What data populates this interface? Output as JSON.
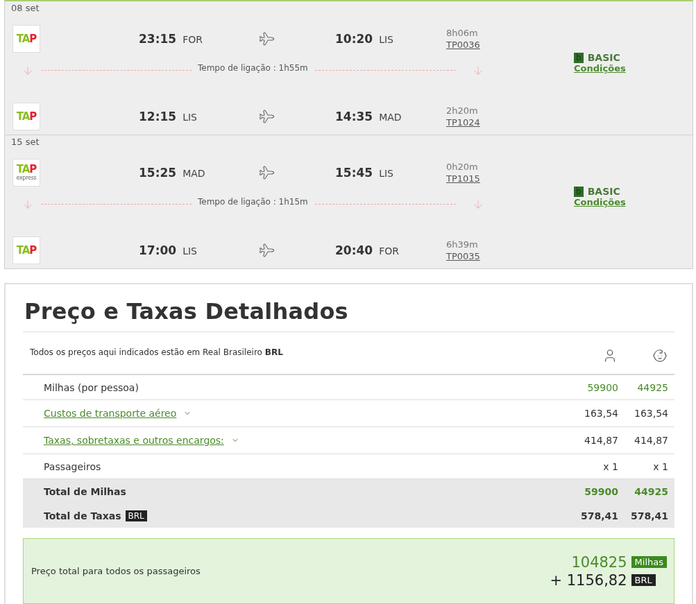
{
  "trips": [
    {
      "date": "08 set",
      "segments": [
        {
          "logo": {
            "text_a": "TA",
            "text_b": "P"
          },
          "dep_time": "23:15",
          "dep_airport": "FOR",
          "arr_time": "10:20",
          "arr_airport": "LIS",
          "duration": "8h06m",
          "flight": "TP0036"
        },
        {
          "logo": {
            "text_a": "TA",
            "text_b": "P"
          },
          "dep_time": "12:15",
          "dep_airport": "LIS",
          "arr_time": "14:35",
          "arr_airport": "MAD",
          "duration": "2h20m",
          "flight": "TP1024"
        }
      ],
      "connection": "Tempo de ligação : 1h55m",
      "fare": {
        "badge": "b",
        "name": "BASIC",
        "link": "Condições"
      }
    },
    {
      "date": "15 set",
      "segments": [
        {
          "logo": {
            "text_a": "TA",
            "text_b": "P",
            "sub": "express"
          },
          "dep_time": "15:25",
          "dep_airport": "MAD",
          "arr_time": "15:45",
          "arr_airport": "LIS",
          "duration": "0h20m",
          "flight": "TP1015"
        },
        {
          "logo": {
            "text_a": "TA",
            "text_b": "P"
          },
          "dep_time": "17:00",
          "dep_airport": "LIS",
          "arr_time": "20:40",
          "arr_airport": "FOR",
          "duration": "6h39m",
          "flight": "TP0035"
        }
      ],
      "connection": "Tempo de ligação : 1h15m",
      "fare": {
        "badge": "b",
        "name": "BASIC",
        "link": "Condições"
      }
    }
  ],
  "prices": {
    "title": "Preço e Taxas Detalhados",
    "note": "Todos os preços aqui indicados estão em Real Brasileiro **BRL**",
    "columns": [
      {
        "kind": "adult"
      },
      {
        "kind": "child"
      }
    ],
    "rows": [
      {
        "kind": "plain",
        "label": "Milhas (por pessoa)",
        "highlight": true,
        "values": [
          "59900",
          "44925"
        ]
      },
      {
        "kind": "link",
        "label": "Custos de transporte aéreo",
        "highlight": false,
        "values": [
          "163,54",
          "163,54"
        ]
      },
      {
        "kind": "link",
        "label": "Taxas, sobretaxas e outros encargos:",
        "highlight": false,
        "values": [
          "414,87",
          "414,87"
        ]
      },
      {
        "kind": "plain",
        "label": "Passageiros",
        "highlight": false,
        "values": [
          "x 1",
          "x 1"
        ]
      },
      {
        "kind": "total",
        "label": "Total de Milhas",
        "highlight": true,
        "values": [
          "59900",
          "44925"
        ]
      },
      {
        "kind": "total",
        "label": "Total de Taxas",
        "tag": "BRL",
        "highlight": false,
        "values": [
          "578,41",
          "578,41"
        ]
      }
    ],
    "total": {
      "label": "Preço total para todos os passageiros",
      "miles": "104825",
      "miles_unit": "Milhas",
      "amount": "+ 1156,82",
      "currency": "BRL"
    }
  }
}
